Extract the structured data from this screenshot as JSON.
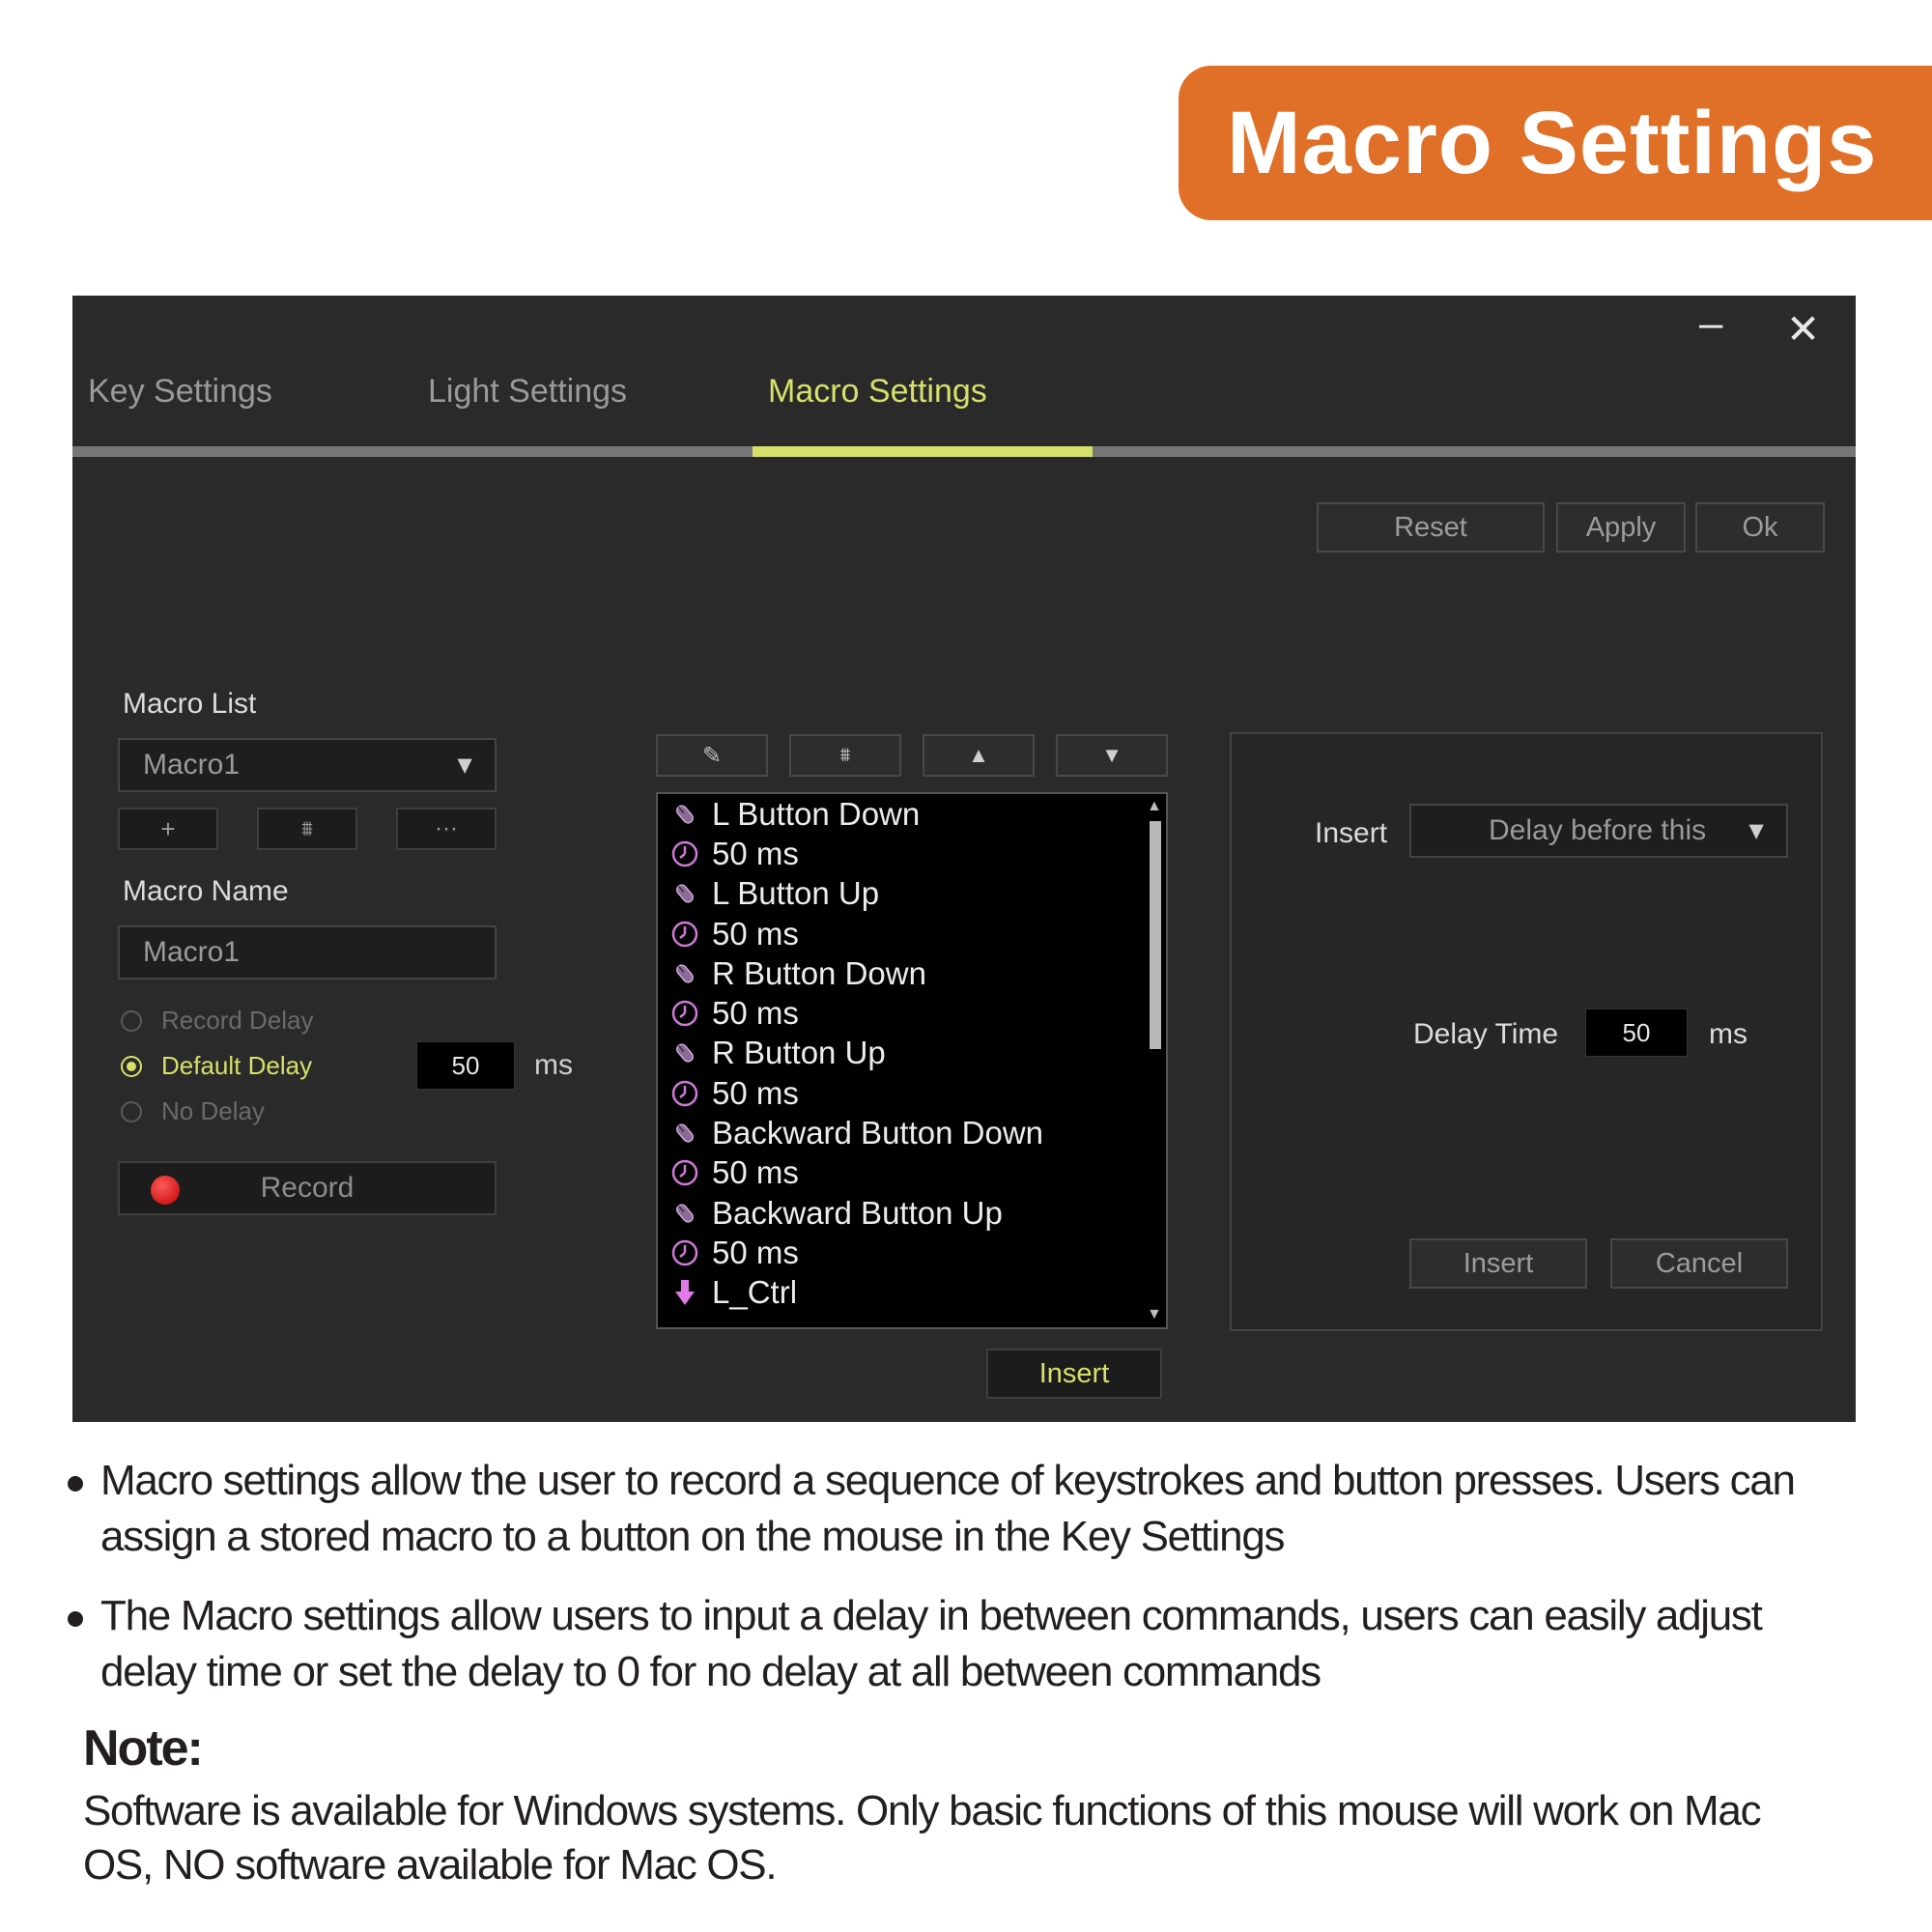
{
  "banner": {
    "title": "Macro Settings"
  },
  "window": {
    "controls": {
      "minimize": "–",
      "close": "✕"
    },
    "tabs": [
      {
        "label": "Key Settings"
      },
      {
        "label": "Light Settings"
      },
      {
        "label": "Macro Settings",
        "active": true
      }
    ],
    "actions": {
      "reset": "Reset",
      "apply": "Apply",
      "ok": "Ok"
    },
    "left": {
      "macro_list_label": "Macro List",
      "macro_list_selected": "Macro1",
      "add": "+",
      "delete": "⩩",
      "more": "···",
      "macro_name_label": "Macro Name",
      "macro_name_value": "Macro1",
      "radios": [
        {
          "label": "Record Delay",
          "checked": false
        },
        {
          "label": "Default Delay",
          "checked": true
        },
        {
          "label": "No Delay",
          "checked": false
        }
      ],
      "default_delay_value": "50",
      "ms": "ms",
      "record": "Record"
    },
    "middle": {
      "toolbar": {
        "edit": "✎",
        "delete": "⩩",
        "up": "▲",
        "down": "▼"
      },
      "events": [
        {
          "icon": "mouse-icon",
          "text": "L Button Down"
        },
        {
          "icon": "clock-icon",
          "text": "50 ms"
        },
        {
          "icon": "mouse-icon",
          "text": "L Button Up"
        },
        {
          "icon": "clock-icon",
          "text": "50 ms"
        },
        {
          "icon": "mouse-icon",
          "text": "R Button Down"
        },
        {
          "icon": "clock-icon",
          "text": "50 ms"
        },
        {
          "icon": "mouse-icon",
          "text": "R Button Up"
        },
        {
          "icon": "clock-icon",
          "text": "50 ms"
        },
        {
          "icon": "mouse-icon",
          "text": "Backward Button Down"
        },
        {
          "icon": "clock-icon",
          "text": "50 ms"
        },
        {
          "icon": "mouse-icon",
          "text": "Backward Button Up"
        },
        {
          "icon": "clock-icon",
          "text": "50 ms"
        },
        {
          "icon": "key-down-icon",
          "text": "L_Ctrl"
        }
      ],
      "insert": "Insert"
    },
    "right": {
      "insert_label": "Insert",
      "insert_mode": "Delay before this",
      "delay_time_label": "Delay Time",
      "delay_time_value": "50",
      "ms": "ms",
      "insert_button": "Insert",
      "cancel_button": "Cancel"
    },
    "colors": {
      "accent": "#d6e06a",
      "banner": "#e06f27",
      "window_bg": "#2a2a2a"
    }
  },
  "description": {
    "bullet1_line1": "Macro settings allow the user to record a sequence of keystrokes and button presses. Users can",
    "bullet1_line2": "assign a stored macro to a button on the mouse in the Key Settings",
    "bullet2_line1": "The Macro settings allow users to input a delay in between commands, users can easily adjust",
    "bullet2_line2": "delay time or set the delay to 0 for no delay at all between commands",
    "note_title": "Note:",
    "note_line1": "Software is available for Windows systems. Only basic functions of this mouse will work on Mac",
    "note_line2": "OS, NO software available for Mac OS."
  }
}
